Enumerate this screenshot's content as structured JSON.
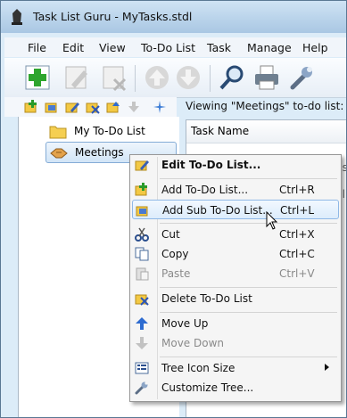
{
  "window": {
    "title": "Task List Guru - MyTasks.stdl"
  },
  "menubar": [
    "File",
    "Edit",
    "View",
    "To-Do List",
    "Task",
    "Manage",
    "Help"
  ],
  "toolbar": {
    "buttons": [
      {
        "name": "add",
        "icon": "add-icon",
        "enabled": true
      },
      {
        "name": "edit",
        "icon": "pencil-icon",
        "enabled": false
      },
      {
        "name": "delete",
        "icon": "delete-icon",
        "enabled": false
      },
      {
        "name": "move-up",
        "icon": "arrow-up-icon",
        "enabled": false
      },
      {
        "name": "move-down",
        "icon": "arrow-down-icon",
        "enabled": false
      },
      {
        "name": "find",
        "icon": "magnifier-icon",
        "enabled": true
      },
      {
        "name": "print",
        "icon": "printer-icon",
        "enabled": true
      },
      {
        "name": "settings",
        "icon": "wrench-icon",
        "enabled": true
      }
    ]
  },
  "tree": {
    "items": [
      {
        "label": "My To-Do List",
        "icon": "folder-icon",
        "selected": false
      },
      {
        "label": "Meetings",
        "icon": "handshake-icon",
        "selected": true
      }
    ]
  },
  "right_pane": {
    "header": "Viewing \"Meetings\" to-do list:",
    "column": "Task Name",
    "partial_1": "cs",
    "partial_2": "cli"
  },
  "context_menu": {
    "items": [
      {
        "label": "Edit To-Do List...",
        "shortcut": "",
        "bold": true,
        "enabled": true,
        "icon": "edit-list-icon"
      },
      {
        "label": "Add To-Do List...",
        "shortcut": "Ctrl+R",
        "enabled": true,
        "icon": "add-list-icon"
      },
      {
        "label": "Add Sub To-Do List...",
        "shortcut": "Ctrl+L",
        "enabled": true,
        "icon": "add-sub-list-icon",
        "highlight": true
      },
      {
        "label": "Cut",
        "shortcut": "Ctrl+X",
        "enabled": true,
        "icon": "scissors-icon"
      },
      {
        "label": "Copy",
        "shortcut": "Ctrl+C",
        "enabled": true,
        "icon": "copy-icon"
      },
      {
        "label": "Paste",
        "shortcut": "Ctrl+V",
        "enabled": false,
        "icon": "paste-icon"
      },
      {
        "label": "Delete To-Do List",
        "shortcut": "",
        "enabled": true,
        "icon": "delete-list-icon"
      },
      {
        "label": "Move Up",
        "shortcut": "",
        "enabled": true,
        "icon": "arrow-up-icon"
      },
      {
        "label": "Move Down",
        "shortcut": "",
        "enabled": false,
        "icon": "arrow-down-icon"
      },
      {
        "label": "Tree Icon Size",
        "shortcut": "",
        "enabled": true,
        "icon": "tree-size-icon",
        "submenu": true
      },
      {
        "label": "Customize Tree...",
        "shortcut": "",
        "enabled": true,
        "icon": "wrench-icon"
      }
    ]
  }
}
